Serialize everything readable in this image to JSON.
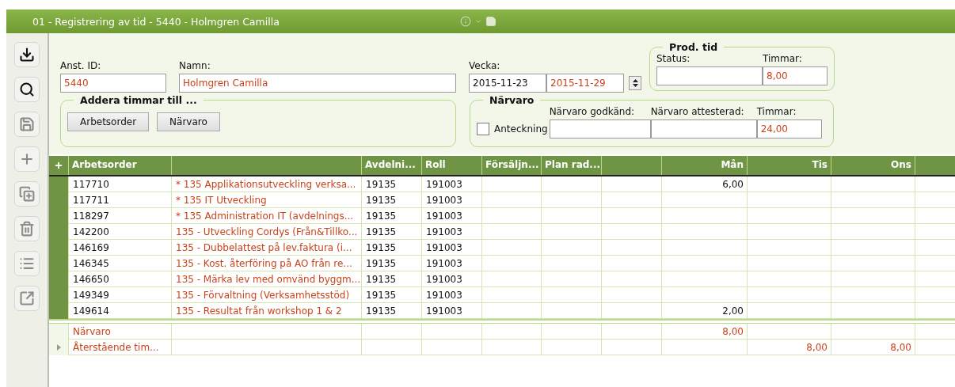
{
  "window": {
    "title": "01 - Registrering av tid - 5440 - Holmgren Camilla"
  },
  "toolbar": [
    {
      "kind": "download",
      "disabled": false
    },
    {
      "kind": "search",
      "disabled": false
    },
    {
      "kind": "save",
      "disabled": true
    },
    {
      "kind": "add",
      "disabled": true
    },
    {
      "kind": "copy",
      "disabled": true
    },
    {
      "kind": "delete",
      "disabled": true
    },
    {
      "kind": "list",
      "disabled": true
    },
    {
      "kind": "expand",
      "disabled": true
    }
  ],
  "employee": {
    "id_label": "Anst. ID:",
    "id_value": "5440",
    "name_label": "Namn:",
    "name_value": "Holmgren Camilla",
    "week_label": "Vecka:",
    "week_start": "2015-11-23",
    "week_end": "2015-11-29"
  },
  "prod_tid": {
    "title": "Prod. tid",
    "status_label": "Status:",
    "hours_label": "Timmar:",
    "hours_value": "8,00"
  },
  "add_hours": {
    "title": "Addera timmar till ...",
    "buttons": [
      "Arbetsorder",
      "Närvaro"
    ]
  },
  "narvaro": {
    "title": "Närvaro",
    "note_label": "Anteckning",
    "note_checked": false,
    "approved_label": "Närvaro godkänd:",
    "attested_label": "Närvaro attesterad:",
    "hours_label": "Timmar:",
    "hours_value": "24,00"
  },
  "table": {
    "columns": [
      "Arbetsorder",
      "Avdelni...",
      "Roll",
      "Försäljn...",
      "Plan rad...",
      "Mån",
      "Tis",
      "Ons"
    ],
    "rows": [
      {
        "kind": "entry",
        "current": false,
        "arbetsorder": "117710",
        "column_2": "* 135 Applikationsutveckling verksa...",
        "avdelning": "19135",
        "roll": "191003",
        "man": "6,00"
      },
      {
        "kind": "entry",
        "current": false,
        "arbetsorder": "117711",
        "column_2": "* 135 IT Utveckling",
        "avdelning": "19135",
        "roll": "191003"
      },
      {
        "kind": "entry",
        "current": false,
        "arbetsorder": "118297",
        "column_2": "* 135 Administration IT (avdelnings...",
        "avdelning": "19135",
        "roll": "191003"
      },
      {
        "kind": "entry",
        "current": false,
        "arbetsorder": "142200",
        "column_2": "135 - Utveckling Cordys (Från&Tillko...",
        "avdelning": "19135",
        "roll": "191003"
      },
      {
        "kind": "entry",
        "current": false,
        "arbetsorder": "146169",
        "column_2": "135 - Dubbelattest på lev.faktura (i...",
        "avdelning": "19135",
        "roll": "191003"
      },
      {
        "kind": "entry",
        "current": false,
        "arbetsorder": "146345",
        "column_2": "135 - Kost. återföring på AO från re...",
        "avdelning": "19135",
        "roll": "191003"
      },
      {
        "kind": "entry",
        "current": false,
        "arbetsorder": "146650",
        "column_2": "135 - Märka lev med omvänd byggm...",
        "avdelning": "19135",
        "roll": "191003"
      },
      {
        "kind": "entry",
        "current": false,
        "arbetsorder": "149349",
        "column_2": "135 - Förvaltning (Verksamhetsstöd)",
        "avdelning": "19135",
        "roll": "191003"
      },
      {
        "kind": "entry",
        "current": false,
        "arbetsorder": "149614",
        "column_2": "135 - Resultat från workshop 1 & 2",
        "avdelning": "19135",
        "roll": "191003",
        "man": "2,00"
      },
      {
        "kind": "summary",
        "current": false,
        "arbetsorder": "Närvaro",
        "man": "8,00"
      },
      {
        "kind": "summary",
        "current": true,
        "arbetsorder": "Återstående tim...",
        "tis": "8,00",
        "ons": "8,00"
      }
    ]
  }
}
